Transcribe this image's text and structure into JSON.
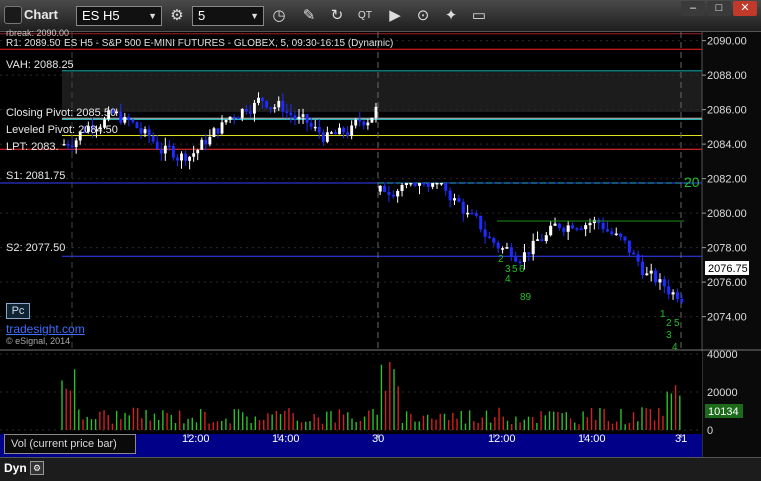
{
  "window": {
    "title": "Chart",
    "symbol": "ES H5",
    "interval": "5",
    "buttons": {
      "minimize": "–",
      "maximize": "□",
      "close": "✕"
    }
  },
  "chart": {
    "heading": "ES H5 - S&P 500 E-MINI FUTURES - GLOBEX, 5, 09:30-16:15 (Dynamic)",
    "heading_prefix": "R1: 2089.50",
    "last_price": "2076.75",
    "volume_value": "10134",
    "price_axis": [
      "2090.00",
      "2088.00",
      "2086.00",
      "2084.00",
      "2082.00",
      "2080.00",
      "2078.00",
      "2076.00",
      "2074.00"
    ],
    "volume_axis": [
      "40000",
      "20000",
      "0"
    ],
    "time_axis": [
      "29",
      "12:00",
      "14:00",
      "30",
      "12:00",
      "14:00",
      "31"
    ],
    "level_labels": {
      "pbreak": "rbreak: 2090.00",
      "vah": "VAH: 2088.25",
      "closing_pivot": "Closing Pivot: 2085.50",
      "leveled_pivot": "Leveled Pivot: 2084.50",
      "lpt": "LPT: 2083.",
      "s1": "S1: 2081.75",
      "s2": "S2: 2077.50"
    },
    "annotations": {
      "big": "20",
      "counts_mid": [
        "2",
        "3",
        "5",
        "6",
        "4",
        "89"
      ],
      "counts_right": [
        "1",
        "2",
        "5",
        "3",
        "4"
      ]
    },
    "colors": {
      "up_candle": "#ffffff",
      "down_candle": "#1f2cff",
      "vol_up": "#2cbf2c",
      "vol_down": "#d42020",
      "accent_green": "#25c025"
    }
  },
  "volume_panel": {
    "label": "Vol (current price bar)"
  },
  "branding": {
    "pc": "Pc",
    "link": "tradesight.com",
    "note": "© eSignal, 2014"
  },
  "bottom": {
    "mode": "Dyn"
  },
  "chart_data": {
    "type": "candlestick",
    "title": "ES H5 - S&P 500 E-MINI FUTURES - GLOBEX, 5, 09:30-16:15 (Dynamic)",
    "ylim": [
      2072.5,
      2090.5
    ],
    "x_ticks": [
      "29",
      "12:00",
      "14:00",
      "30",
      "12:00",
      "14:00",
      "31"
    ],
    "sessions": [
      {
        "name": "29",
        "open": 2084.0,
        "close": 2086.0,
        "range": [
          2081.0,
          2088.5
        ],
        "bars": 78
      },
      {
        "name": "30",
        "open": 2081.25,
        "close": 2076.75,
        "range": [
          2073.25,
          2081.75
        ],
        "bars": 70
      }
    ],
    "levels": [
      {
        "label": "R1",
        "value": 2089.5
      },
      {
        "label": "VAH",
        "value": 2088.25
      },
      {
        "label": "Closing Pivot",
        "value": 2085.5
      },
      {
        "label": "Leveled Pivot",
        "value": 2084.5
      },
      {
        "label": "S1",
        "value": 2081.75
      },
      {
        "label": "S2",
        "value": 2077.5
      }
    ],
    "last": 2076.75,
    "volume": {
      "last": 10134,
      "ylim": [
        0,
        40000
      ]
    }
  }
}
